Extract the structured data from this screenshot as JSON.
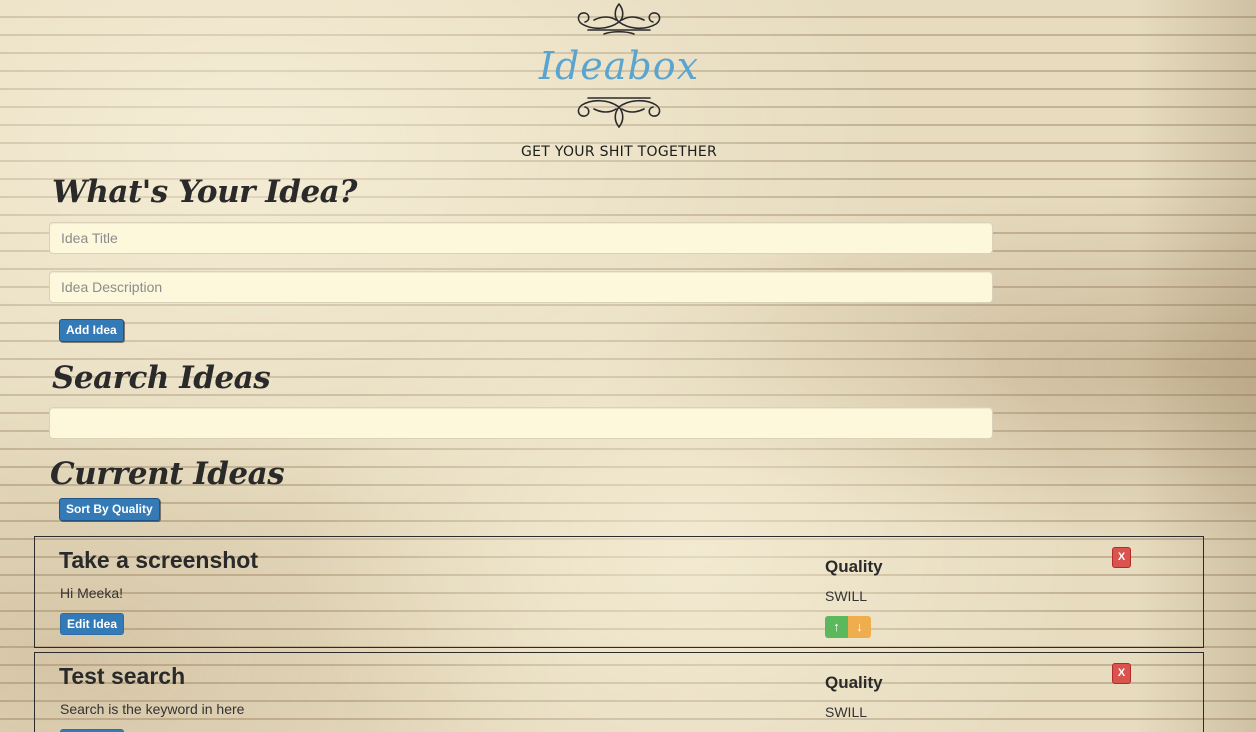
{
  "header": {
    "logo": "Ideabox",
    "tagline": "GET YOUR SHIT TOGETHER"
  },
  "new_idea": {
    "heading": "What's Your Idea?",
    "title_placeholder": "Idea Title",
    "title_value": "",
    "description_placeholder": "Idea Description",
    "description_value": "",
    "add_button": "Add Idea"
  },
  "search": {
    "heading": "Search Ideas",
    "placeholder": "",
    "value": ""
  },
  "ideas": {
    "heading": "Current Ideas",
    "sort_button": "Sort By Quality",
    "quality_label": "Quality",
    "edit_label": "Edit Idea",
    "delete_label": "X",
    "upvote_icon": "arrow-up-icon",
    "downvote_icon": "arrow-down-icon",
    "items": [
      {
        "title": "Take a screenshot",
        "body": "Hi Meeka!",
        "quality": "SWILL"
      },
      {
        "title": "Test search",
        "body": "Search is the keyword in here",
        "quality": "SWILL"
      }
    ]
  },
  "colors": {
    "accent_blue": "#337ab7",
    "logo_blue": "#5aa5cf",
    "upvote_green": "#5cb85c",
    "downvote_orange": "#f0ad4e",
    "delete_red": "#d9534f",
    "input_bg": "#fdf7dc"
  }
}
